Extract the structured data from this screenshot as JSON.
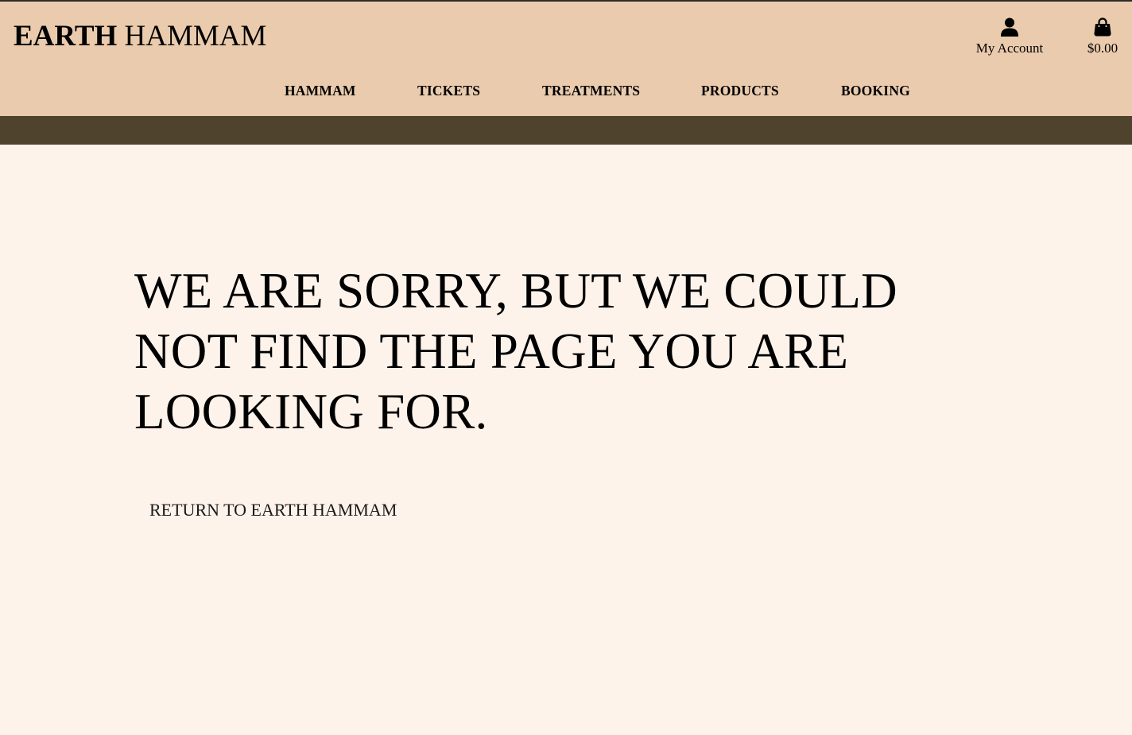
{
  "brand": {
    "bold": "EARTH",
    "light": "HAMMAM"
  },
  "header": {
    "account_label": "My Account",
    "account_icon": "user-icon",
    "bag_total": "$0.00",
    "bag_icon": "shopping-bag-icon"
  },
  "nav": {
    "items": [
      {
        "label": "HAMMAM"
      },
      {
        "label": "TICKETS"
      },
      {
        "label": "TREATMENTS"
      },
      {
        "label": "PRODUCTS"
      },
      {
        "label": "BOOKING"
      }
    ]
  },
  "main": {
    "error_message": "WE ARE SORRY, BUT WE COULD NOT FIND THE PAGE YOU ARE LOOKING FOR.",
    "return_link": "RETURN TO EARTH HAMMAM"
  },
  "colors": {
    "header_bg": "#eacbad",
    "band_bg": "#50432e",
    "page_bg": "#fdf3eb"
  }
}
